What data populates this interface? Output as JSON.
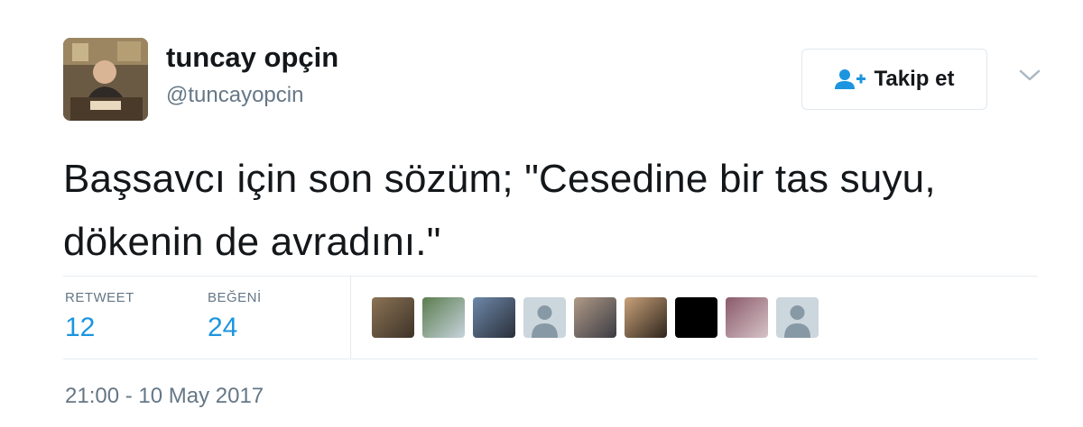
{
  "user": {
    "display_name": "tuncay opçin",
    "handle": "@tuncayopcin"
  },
  "follow_button": {
    "label": "Takip et",
    "icon": "add-user-icon"
  },
  "menu": {
    "icon": "chevron-down-icon"
  },
  "tweet": {
    "text": "Başsavcı için son sözüm; \"Cesedine bir tas suyu, dökenin de avradını.\"",
    "timestamp": "21:00 - 10 May 2017"
  },
  "stats": {
    "retweet_label": "RETWEET",
    "retweet_count": "12",
    "like_label": "BEĞENİ",
    "like_count": "24"
  },
  "likers": [
    {
      "kind": "photo",
      "colors": [
        "#8b7355",
        "#3d3328"
      ]
    },
    {
      "kind": "photo",
      "colors": [
        "#5b7d4f",
        "#c7d3dc"
      ]
    },
    {
      "kind": "photo",
      "colors": [
        "#6d88a8",
        "#2a2f3a"
      ]
    },
    {
      "kind": "default"
    },
    {
      "kind": "photo",
      "colors": [
        "#b09a86",
        "#3b3b44"
      ]
    },
    {
      "kind": "photo",
      "colors": [
        "#c9a27a",
        "#2e241c"
      ]
    },
    {
      "kind": "photo",
      "colors": [
        "#000000",
        "#000000"
      ]
    },
    {
      "kind": "photo",
      "colors": [
        "#8a5a6a",
        "#d6c3c8"
      ]
    },
    {
      "kind": "default"
    }
  ],
  "colors": {
    "link_blue": "#1b95e0",
    "muted_gray": "#657786",
    "border": "#e1e8ed",
    "default_avatar_bg": "#ccd6dd"
  }
}
